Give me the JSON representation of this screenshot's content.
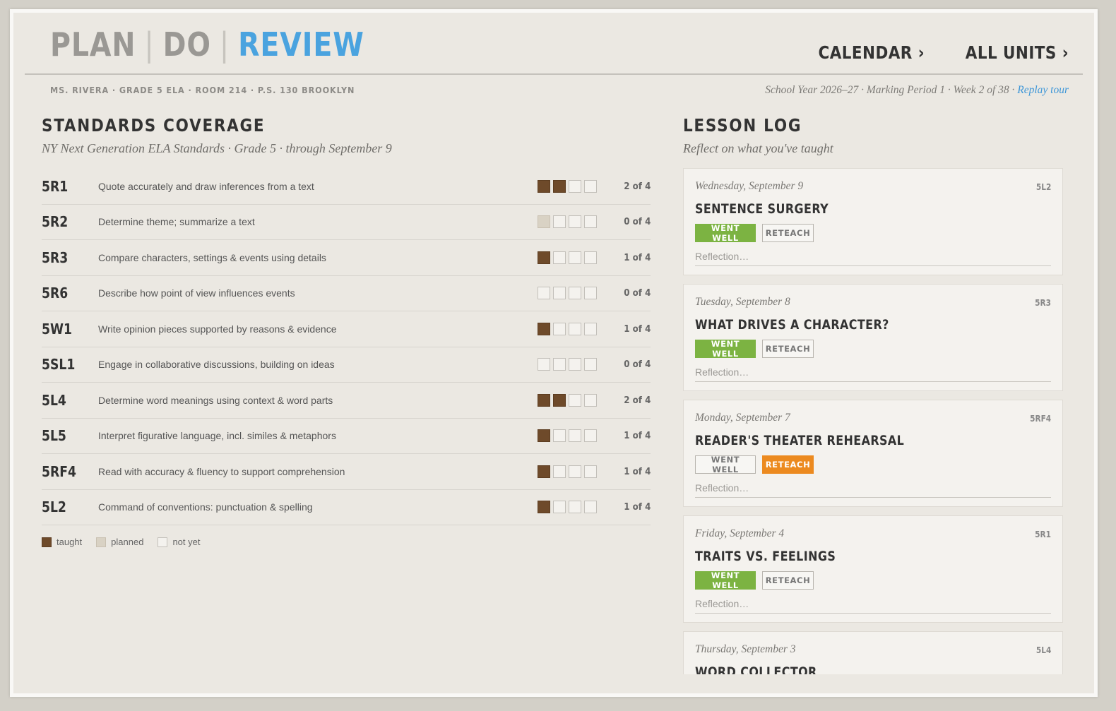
{
  "nav": {
    "plan": "PLAN",
    "do": "DO",
    "review": "REVIEW",
    "divider": "|",
    "calendar": "CALENDAR ›",
    "all_units": "ALL UNITS ›"
  },
  "meta": {
    "teacher": "MS. RIVERA · GRADE 5 ELA · ROOM 214 · P.S. 130 BROOKLYN",
    "school_year": "School Year 2026–27 · Marking Period 1 · Week 2 of 38 · ",
    "replay_tour": "Replay tour"
  },
  "standards": {
    "title": "STANDARDS COVERAGE",
    "subtitle": "NY Next Generation ELA Standards · Grade 5 · through September 9",
    "rows": [
      {
        "code": "5R1",
        "desc": "Quote accurately and draw inferences from a text",
        "boxes": [
          "taught",
          "taught",
          "not",
          "not"
        ],
        "count": "2 of 4"
      },
      {
        "code": "5R2",
        "desc": "Determine theme; summarize a text",
        "boxes": [
          "planned",
          "not",
          "not",
          "not"
        ],
        "count": "0 of 4"
      },
      {
        "code": "5R3",
        "desc": "Compare characters, settings & events using details",
        "boxes": [
          "taught",
          "not",
          "not",
          "not"
        ],
        "count": "1 of 4"
      },
      {
        "code": "5R6",
        "desc": "Describe how point of view influences events",
        "boxes": [
          "not",
          "not",
          "not",
          "not"
        ],
        "count": "0 of 4"
      },
      {
        "code": "5W1",
        "desc": "Write opinion pieces supported by reasons & evidence",
        "boxes": [
          "taught",
          "not",
          "not",
          "not"
        ],
        "count": "1 of 4"
      },
      {
        "code": "5SL1",
        "desc": "Engage in collaborative discussions, building on ideas",
        "boxes": [
          "not",
          "not",
          "not",
          "not"
        ],
        "count": "0 of 4"
      },
      {
        "code": "5L4",
        "desc": "Determine word meanings using context & word parts",
        "boxes": [
          "taught",
          "taught",
          "not",
          "not"
        ],
        "count": "2 of 4"
      },
      {
        "code": "5L5",
        "desc": "Interpret figurative language, incl. similes & metaphors",
        "boxes": [
          "taught",
          "not",
          "not",
          "not"
        ],
        "count": "1 of 4"
      },
      {
        "code": "5RF4",
        "desc": "Read with accuracy & fluency to support comprehension",
        "boxes": [
          "taught",
          "not",
          "not",
          "not"
        ],
        "count": "1 of 4"
      },
      {
        "code": "5L2",
        "desc": "Command of conventions: punctuation & spelling",
        "boxes": [
          "taught",
          "not",
          "not",
          "not"
        ],
        "count": "1 of 4"
      }
    ],
    "legend": {
      "taught": "taught",
      "planned": "planned",
      "not_yet": "not yet"
    }
  },
  "lesson_log": {
    "title": "LESSON LOG",
    "subtitle": "Reflect on what you've taught",
    "went_well_label": "WENT WELL",
    "reteach_label": "RETEACH",
    "reflection_placeholder": "Reflection…",
    "cards": [
      {
        "date": "Wednesday, September 9",
        "code": "5L2",
        "title": "SENTENCE SURGERY",
        "status": "went_well"
      },
      {
        "date": "Tuesday, September 8",
        "code": "5R3",
        "title": "WHAT DRIVES A CHARACTER?",
        "status": "went_well"
      },
      {
        "date": "Monday, September 7",
        "code": "5RF4",
        "title": "READER'S THEATER REHEARSAL",
        "status": "reteach"
      },
      {
        "date": "Friday, September 4",
        "code": "5R1",
        "title": "TRAITS VS. FEELINGS",
        "status": "went_well"
      },
      {
        "date": "Thursday, September 3",
        "code": "5L4",
        "title": "WORD COLLECTOR",
        "status": "none"
      }
    ]
  },
  "colors": {
    "accent": "#4aa3df",
    "taught": "#6e4a2a",
    "planned": "#d9d2c4",
    "went_well": "#7cb342",
    "reteach": "#ec8a1f"
  }
}
